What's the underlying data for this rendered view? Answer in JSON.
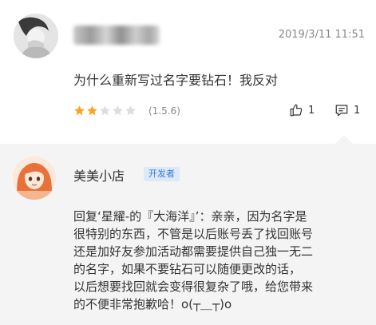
{
  "review": {
    "avatar_icon": "user-avatar-photo",
    "username": "",
    "timestamp": "2019/3/11 11:51",
    "text": "为什么重新写过名字要钻石！我反对",
    "rating": {
      "value": 2,
      "max": 5,
      "filled_color": "#f5a623",
      "empty_color": "#dddddd"
    },
    "version": "(1.5.6)",
    "likes": {
      "icon": "thumbs-up-icon",
      "count": "1"
    },
    "comments": {
      "icon": "comment-icon",
      "count": "1"
    }
  },
  "reply": {
    "avatar_icon": "developer-avatar-illustration",
    "name": "美美小店",
    "badge": "开发者",
    "badge_color": "#3a7bd5",
    "lines": [
      "回复‘星耀-的『大海洋』’：亲亲，因为名字是",
      "很特别的东西，不管是以后账号丢了找回账号",
      "还是加好友参加活动都需要提供自己独一无二",
      "的名字，如果不要钻石可以随便更改的话，",
      "以后想要找回就会变得很复杂了哦，给您带来",
      "的不便非常抱歉哈！o(┬＿┬)o"
    ]
  }
}
